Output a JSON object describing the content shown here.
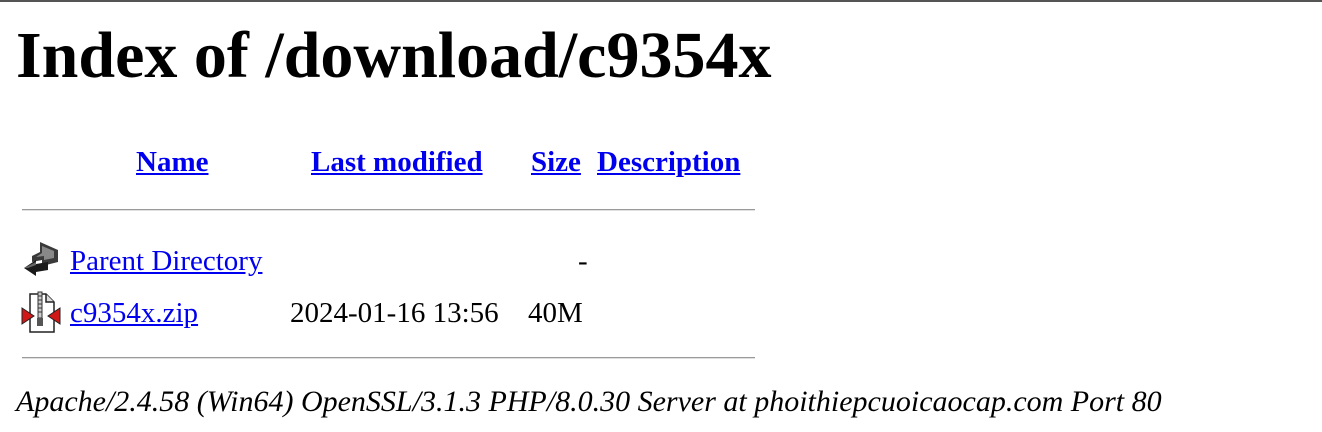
{
  "page_title": "Index of /download/c9354x",
  "columns": {
    "name": "Name",
    "last_modified": "Last modified",
    "size": "Size",
    "description": "Description"
  },
  "rows": [
    {
      "icon": "back-icon",
      "name": "Parent Directory",
      "last_modified": "",
      "size": "-",
      "description": ""
    },
    {
      "icon": "compressed-file-icon",
      "name": "c9354x.zip",
      "last_modified": "2024-01-16 13:56",
      "size": "40M",
      "description": ""
    }
  ],
  "server_signature": "Apache/2.4.58 (Win64) OpenSSL/3.1.3 PHP/8.0.30 Server at phoithiepcuoicaocap.com Port 80",
  "colors": {
    "link": "#0000ee",
    "rule": "#9a9a9a"
  }
}
